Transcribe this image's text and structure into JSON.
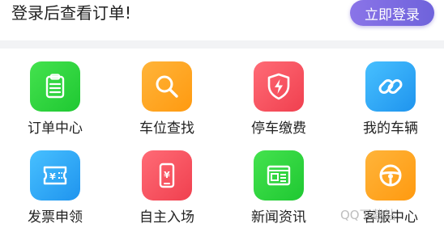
{
  "header": {
    "title": "登录后查看订单!",
    "login_button": "立即登录"
  },
  "items": [
    {
      "label": "订单中心",
      "icon": "clipboard-icon",
      "color": "#2ed63a"
    },
    {
      "label": "车位查找",
      "icon": "search-icon",
      "color": "#ffa31a"
    },
    {
      "label": "停车缴费",
      "icon": "shield-bolt-icon",
      "color": "#f5515f"
    },
    {
      "label": "我的车辆",
      "icon": "link-icon",
      "color": "#2fa7f4"
    },
    {
      "label": "发票申领",
      "icon": "invoice-icon",
      "color": "#2fa7f4"
    },
    {
      "label": "自主入场",
      "icon": "phone-yen-icon",
      "color": "#f5515f"
    },
    {
      "label": "新闻资讯",
      "icon": "news-icon",
      "color": "#2ed63a"
    },
    {
      "label": "客服中心",
      "icon": "steering-wheel-icon",
      "color": "#ffa31a"
    }
  ],
  "watermark": "QQ下载站"
}
